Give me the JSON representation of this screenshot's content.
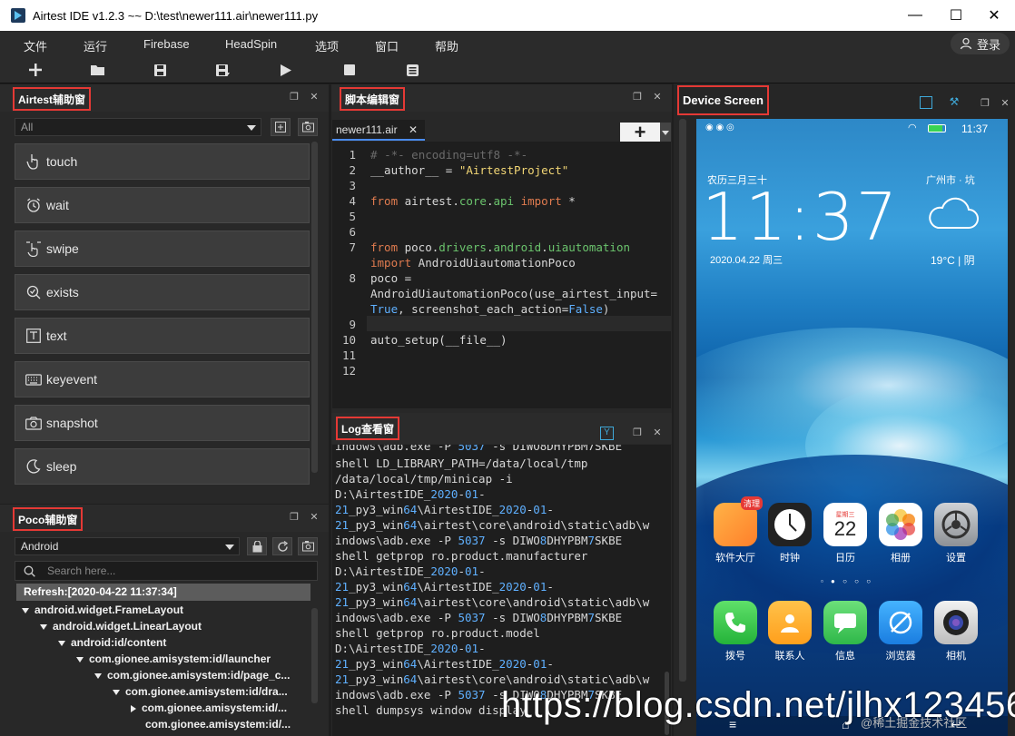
{
  "window": {
    "title": "Airtest IDE v1.2.3 ~~ D:\\test\\newer111.air\\newer111.py",
    "minimize": "—",
    "maximize": "☐",
    "close": "✕"
  },
  "menu": {
    "items": [
      "文件",
      "运行",
      "Firebase",
      "HeadSpin",
      "选项",
      "窗口",
      "帮助"
    ],
    "login": "登录"
  },
  "toolbar": {
    "icons": [
      "new-file-icon",
      "open-folder-icon",
      "save-icon",
      "save-as-icon",
      "run-icon",
      "stop-icon",
      "log-icon"
    ]
  },
  "airtest_panel": {
    "title": "Airtest辅助窗",
    "filter_value": "All",
    "buttons": [
      "touch",
      "wait",
      "swipe",
      "exists",
      "text",
      "keyevent",
      "snapshot",
      "sleep"
    ]
  },
  "poco_panel": {
    "title": "Poco辅助窗",
    "platform": "Android",
    "search_placeholder": "Search here...",
    "refresh": "Refresh:[2020-04-22 11:37:34]",
    "tree": [
      "android.widget.FrameLayout",
      "android.widget.LinearLayout",
      "android:id/content",
      "com.gionee.amisystem:id/launcher",
      "com.gionee.amisystem:id/page_c...",
      "com.gionee.amisystem:id/dra...",
      "com.gionee.amisystem:id/...",
      "com.gionee.amisystem:id/..."
    ]
  },
  "editor": {
    "title": "脚本编辑窗",
    "tab": "newer111.air",
    "plus": "+",
    "line_numbers": [
      "1",
      "2",
      "3",
      "4",
      "5",
      "6",
      "7",
      "",
      "8",
      "",
      "9",
      "10",
      "11",
      "12"
    ]
  },
  "log_panel": {
    "title": "Log查看窗"
  },
  "device_panel": {
    "title": "Device Screen",
    "phone": {
      "time_status": "11:37",
      "lunar": "农历三月三十",
      "city": "广州市 · 坑",
      "clock": "11:37",
      "date": "2020.04.22 周三",
      "weather": "19°C | 阴",
      "apps_row1": [
        "软件大厅",
        "时钟",
        "日历",
        "相册",
        "设置"
      ],
      "apps_row2": [
        "拨号",
        "联系人",
        "信息",
        "浏览器",
        "相机"
      ],
      "calendar_day": "22",
      "calendar_weekday": "星期三",
      "badge": "清理"
    }
  },
  "watermark": "https://blog.csdn.net/jlhx123456",
  "watermark2": "@稀土掘金技术社区"
}
